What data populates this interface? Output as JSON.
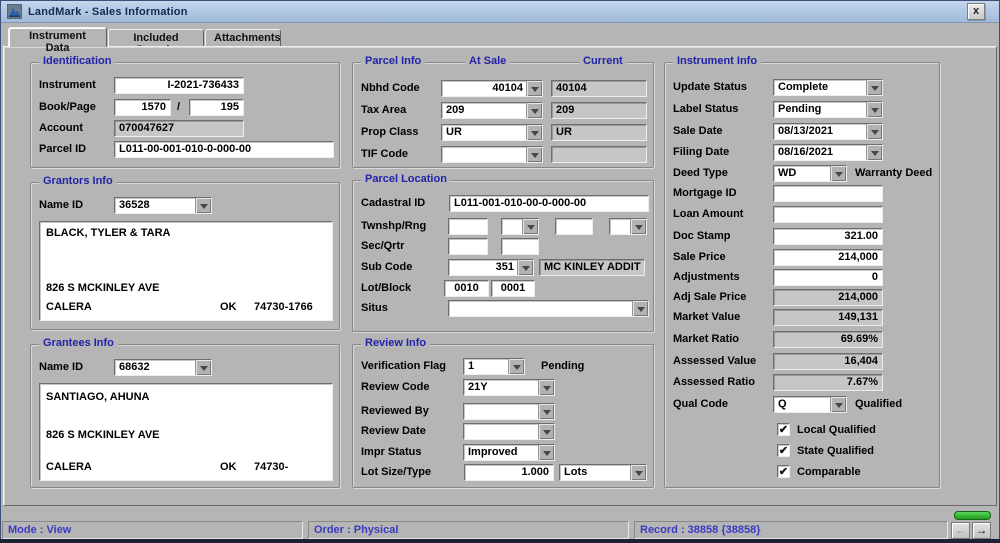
{
  "window": {
    "title": "LandMark - Sales Information",
    "close_label": "x"
  },
  "tabs": {
    "instrument_data": "Instrument Data",
    "included_parcels": "Included Parcels",
    "attachments": "Attachments"
  },
  "identification": {
    "title": "Identification",
    "instrument_label": "Instrument",
    "instrument_value": "I-2021-736433",
    "book_page_label": "Book/Page",
    "book_value": "1570",
    "separator": "/",
    "page_value": "195",
    "account_label": "Account",
    "account_value": "070047627",
    "parcel_id_label": "Parcel ID",
    "parcel_id_value": "L011-00-001-010-0-000-00"
  },
  "grantors": {
    "title": "Grantors Info",
    "name_id_label": "Name ID",
    "name_id_value": "36528",
    "name": "BLACK, TYLER & TARA",
    "address": "826 S MCKINLEY AVE",
    "city": "CALERA",
    "state": "OK",
    "zip": "74730-1766"
  },
  "grantees": {
    "title": "Grantees Info",
    "name_id_label": "Name ID",
    "name_id_value": "68632",
    "name": "SANTIAGO, AHUNA",
    "address": "826 S MCKINLEY AVE",
    "city": "CALERA",
    "state": "OK",
    "zip": "74730-"
  },
  "parcel_info": {
    "title": "Parcel Info",
    "at_sale_header": "At Sale",
    "current_header": "Current",
    "nbhd": {
      "label": "Nbhd Code",
      "at_sale": "40104",
      "current": "40104"
    },
    "tax": {
      "label": "Tax Area",
      "at_sale": "209",
      "current": "209"
    },
    "prop": {
      "label": "Prop Class",
      "at_sale": "UR",
      "current": "UR"
    },
    "tif": {
      "label": "TIF Code",
      "at_sale": "",
      "current": ""
    }
  },
  "parcel_location": {
    "title": "Parcel Location",
    "cadastral_label": "Cadastral ID",
    "cadastral_value": "L011-001-010-00-0-000-00",
    "twnshp_label": "Twnshp/Rng",
    "twnshp_1": "",
    "twnshp_2": "",
    "twnshp_3": "",
    "twnshp_4": "",
    "sec_label": "Sec/Qrtr",
    "sec_1": "",
    "sec_2": "",
    "sub_label": "Sub Code",
    "sub_code": "351",
    "sub_name": "MC KINLEY ADDIT",
    "lot_label": "Lot/Block",
    "lot_value": "0010",
    "block_value": "0001",
    "situs_label": "Situs",
    "situs_value": ""
  },
  "review_info": {
    "title": "Review Info",
    "verification_label": "Verification Flag",
    "verification_value": "1",
    "verification_status": "Pending",
    "review_code_label": "Review Code",
    "review_code_value": "21Y",
    "reviewed_by_label": "Reviewed By",
    "reviewed_by_value": "",
    "review_date_label": "Review Date",
    "review_date_value": "",
    "impr_status_label": "Impr Status",
    "impr_status_value": "Improved",
    "lot_size_label": "Lot Size/Type",
    "lot_size_value": "1.000",
    "lot_type_value": "Lots"
  },
  "instrument_info": {
    "title": "Instrument Info",
    "update_status_label": "Update Status",
    "update_status_value": "Complete",
    "label_status_label": "Label Status",
    "label_status_value": "Pending",
    "sale_date_label": "Sale Date",
    "sale_date_value": "08/13/2021",
    "filing_date_label": "Filing Date",
    "filing_date_value": "08/16/2021",
    "deed_type_label": "Deed Type",
    "deed_type_value": "WD",
    "deed_type_desc": "Warranty Deed",
    "mortgage_id_label": "Mortgage ID",
    "mortgage_id_value": "",
    "loan_amount_label": "Loan Amount",
    "loan_amount_value": "",
    "doc_stamp_label": "Doc Stamp",
    "doc_stamp_value": "321.00",
    "sale_price_label": "Sale Price",
    "sale_price_value": "214,000",
    "adjustments_label": "Adjustments",
    "adjustments_value": "0",
    "adj_sale_price_label": "Adj Sale Price",
    "adj_sale_price_value": "214,000",
    "market_value_label": "Market Value",
    "market_value_value": "149,131",
    "market_ratio_label": "Market Ratio",
    "market_ratio_value": "69.69%",
    "assessed_value_label": "Assessed Value",
    "assessed_value_value": "16,404",
    "assessed_ratio_label": "Assessed Ratio",
    "assessed_ratio_value": "7.67%",
    "qual_code_label": "Qual Code",
    "qual_code_value": "Q",
    "qual_code_desc": "Qualified",
    "local_qualified_label": "Local Qualified",
    "local_qualified_checked": true,
    "state_qualified_label": "State Qualified",
    "state_qualified_checked": true,
    "comparable_label": "Comparable",
    "comparable_checked": true
  },
  "status_bar": {
    "mode": "Mode : View",
    "order": "Order : Physical",
    "record": "Record : 38858 {38858}"
  },
  "colors": {
    "title_bar": "#a9c2de",
    "form_background": "#b5b5b5",
    "field_readonly": "#c6c6c6",
    "group_label": "#2222aa",
    "status_text": "#3a3ac2",
    "green_indicator": "#2db82d"
  }
}
